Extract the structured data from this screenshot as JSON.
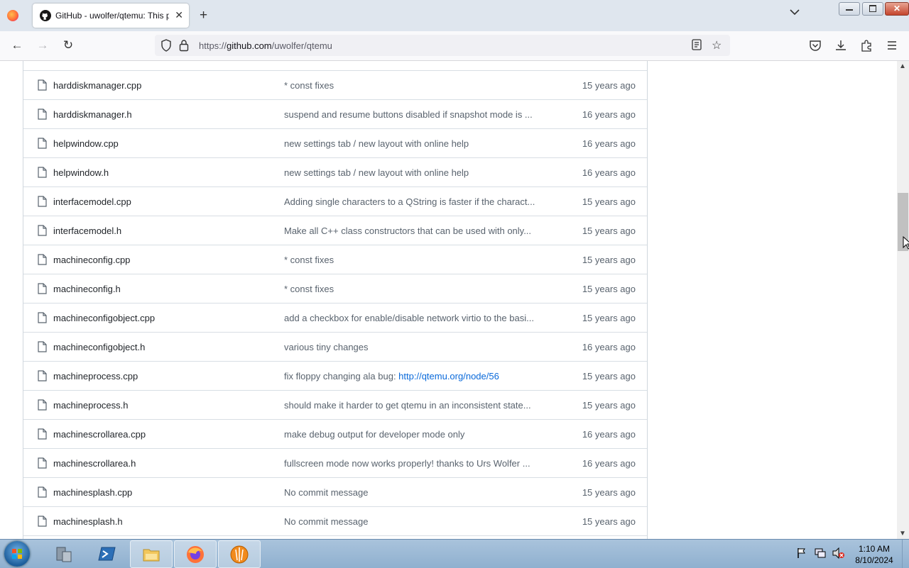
{
  "browser": {
    "tab_title": "GitHub - uwolfer/qtemu: This p",
    "url_prefix": "https://",
    "url_domain": "github.com",
    "url_path": "/uwolfer/qtemu"
  },
  "files": [
    {
      "name": "harddiskmanager.cpp",
      "message": "* const fixes",
      "age": "15 years ago"
    },
    {
      "name": "harddiskmanager.h",
      "message": "suspend and resume buttons disabled if snapshot mode is ...",
      "age": "16 years ago"
    },
    {
      "name": "helpwindow.cpp",
      "message": "new settings tab / new layout with online help",
      "age": "16 years ago"
    },
    {
      "name": "helpwindow.h",
      "message": "new settings tab / new layout with online help",
      "age": "16 years ago"
    },
    {
      "name": "interfacemodel.cpp",
      "message": "Adding single characters to a QString is faster if the charact...",
      "age": "15 years ago"
    },
    {
      "name": "interfacemodel.h",
      "message": "Make all C++ class constructors that can be used with only...",
      "age": "15 years ago"
    },
    {
      "name": "machineconfig.cpp",
      "message": "* const fixes",
      "age": "15 years ago"
    },
    {
      "name": "machineconfig.h",
      "message": "* const fixes",
      "age": "15 years ago"
    },
    {
      "name": "machineconfigobject.cpp",
      "message": "add a checkbox for enable/disable network virtio to the basi...",
      "age": "15 years ago"
    },
    {
      "name": "machineconfigobject.h",
      "message": "various tiny changes",
      "age": "16 years ago"
    },
    {
      "name": "machineprocess.cpp",
      "message": "fix floppy changing ala bug: ",
      "link": "http://qtemu.org/node/56",
      "age": "15 years ago"
    },
    {
      "name": "machineprocess.h",
      "message": "should make it harder to get qtemu in an inconsistent state...",
      "age": "15 years ago"
    },
    {
      "name": "machinescrollarea.cpp",
      "message": "make debug output for developer mode only",
      "age": "16 years ago"
    },
    {
      "name": "machinescrollarea.h",
      "message": "fullscreen mode now works properly! thanks to Urs Wolfer ...",
      "age": "16 years ago"
    },
    {
      "name": "machinesplash.cpp",
      "message": "No commit message",
      "age": "15 years ago"
    },
    {
      "name": "machinesplash.h",
      "message": "No commit message",
      "age": "15 years ago"
    }
  ],
  "taskbar": {
    "time": "1:10 AM",
    "date": "8/10/2024"
  }
}
